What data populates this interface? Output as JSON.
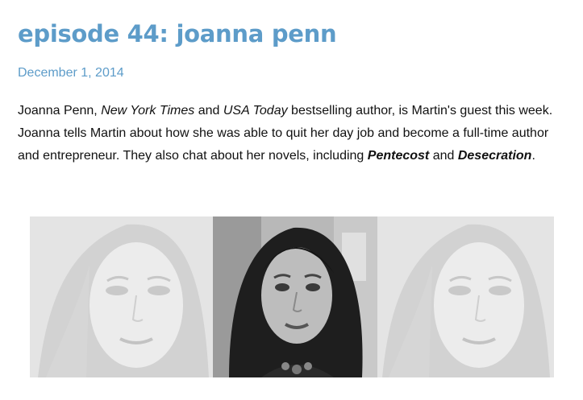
{
  "post": {
    "title": "episode 44: joanna penn",
    "date": "December 1, 2014",
    "body": {
      "part1": "Joanna Penn, ",
      "publication1": "New York Times",
      "part2": " and ",
      "publication2": "USA Today",
      "part3": " bestselling author, is Martin's guest this week. Joanna tells Martin about how she was able to quit her day job and become a full-time author and entrepreneur. They also chat about her novels, including ",
      "novel1": "Pentecost",
      "part4": " and ",
      "novel2": "Desecration",
      "part5": "."
    }
  },
  "images": {
    "left_alt": "faded portrait",
    "center_alt": "portrait photo",
    "right_alt": "faded portrait"
  }
}
